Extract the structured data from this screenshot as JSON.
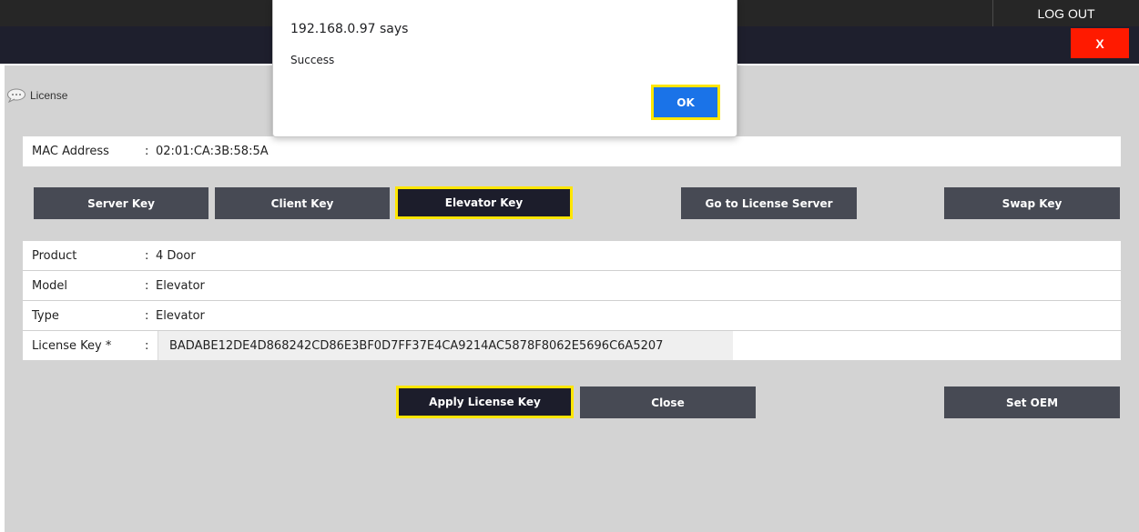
{
  "header": {
    "logout_label": "LOG OUT",
    "close_label": "X"
  },
  "page": {
    "title": "License",
    "title_icon": "speech-bubble-icon"
  },
  "mac": {
    "label": "MAC Address",
    "colon": ":",
    "value": "02:01:CA:3B:58:5A"
  },
  "key_buttons": {
    "server": "Server Key",
    "client": "Client Key",
    "elevator": "Elevator Key",
    "license_server": "Go to License Server",
    "swap": "Swap Key"
  },
  "details": {
    "product_label": "Product",
    "product_value": "4 Door",
    "model_label": "Model",
    "model_value": "Elevator",
    "type_label": "Type",
    "type_value": "Elevator",
    "license_label": "License Key *",
    "license_value": "BADABE12DE4D868242CD86E3BF0D7FF37E4CA9214AC5878F8062E5696C6A5207",
    "colon": ":"
  },
  "actions": {
    "apply": "Apply License Key",
    "close": "Close",
    "set_oem": "Set OEM"
  },
  "dialog": {
    "title": "192.168.0.97 says",
    "message": "Success",
    "ok_label": "OK"
  },
  "colors": {
    "highlight": "#ffe600",
    "close_red": "#ff1a00",
    "button_gray": "#474a54",
    "button_active": "#1c1d2b",
    "ok_blue": "#1a73e8"
  }
}
